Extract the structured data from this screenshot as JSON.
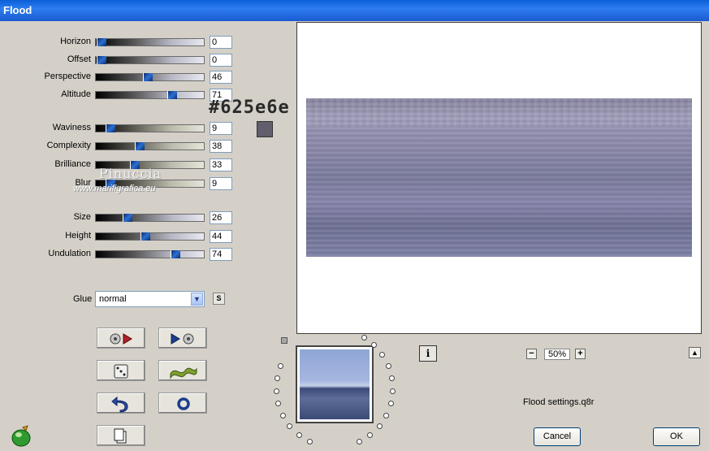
{
  "window": {
    "title": "Flood"
  },
  "sliders": [
    {
      "key": "horizon",
      "label": "Horizon",
      "value": "0",
      "fraction": 0.0,
      "style": "a"
    },
    {
      "key": "offset",
      "label": "Offset",
      "value": "0",
      "fraction": 0.0,
      "style": "a"
    },
    {
      "key": "perspective",
      "label": "Perspective",
      "value": "46",
      "fraction": 0.46,
      "style": "a"
    },
    {
      "key": "altitude",
      "label": "Altitude",
      "value": "71",
      "fraction": 0.71,
      "style": "a"
    },
    {
      "key": "waviness",
      "label": "Waviness",
      "value": "9",
      "fraction": 0.09,
      "style": "b"
    },
    {
      "key": "complexity",
      "label": "Complexity",
      "value": "38",
      "fraction": 0.38,
      "style": "b"
    },
    {
      "key": "brilliance",
      "label": "Brilliance",
      "value": "33",
      "fraction": 0.33,
      "style": "b"
    },
    {
      "key": "blur",
      "label": "Blur",
      "value": "9",
      "fraction": 0.09,
      "style": "b"
    },
    {
      "key": "size",
      "label": "Size",
      "value": "26",
      "fraction": 0.26,
      "style": "a"
    },
    {
      "key": "height",
      "label": "Height",
      "value": "44",
      "fraction": 0.44,
      "style": "a"
    },
    {
      "key": "undulation",
      "label": "Undulation",
      "value": "74",
      "fraction": 0.74,
      "style": "a"
    }
  ],
  "color": {
    "hex_label": "#625e6e",
    "swatch": "#625e6e"
  },
  "watermark": {
    "name": "Pinuccia",
    "url": "www.marifigrafica.eu"
  },
  "glue": {
    "label": "Glue",
    "value": "normal",
    "s_button": "S"
  },
  "zoom": {
    "minus": "−",
    "value": "50%",
    "plus": "+"
  },
  "preset": {
    "file": "Flood settings.q8r"
  },
  "buttons": {
    "cancel": "Cancel",
    "ok": "OK",
    "info": "i"
  }
}
